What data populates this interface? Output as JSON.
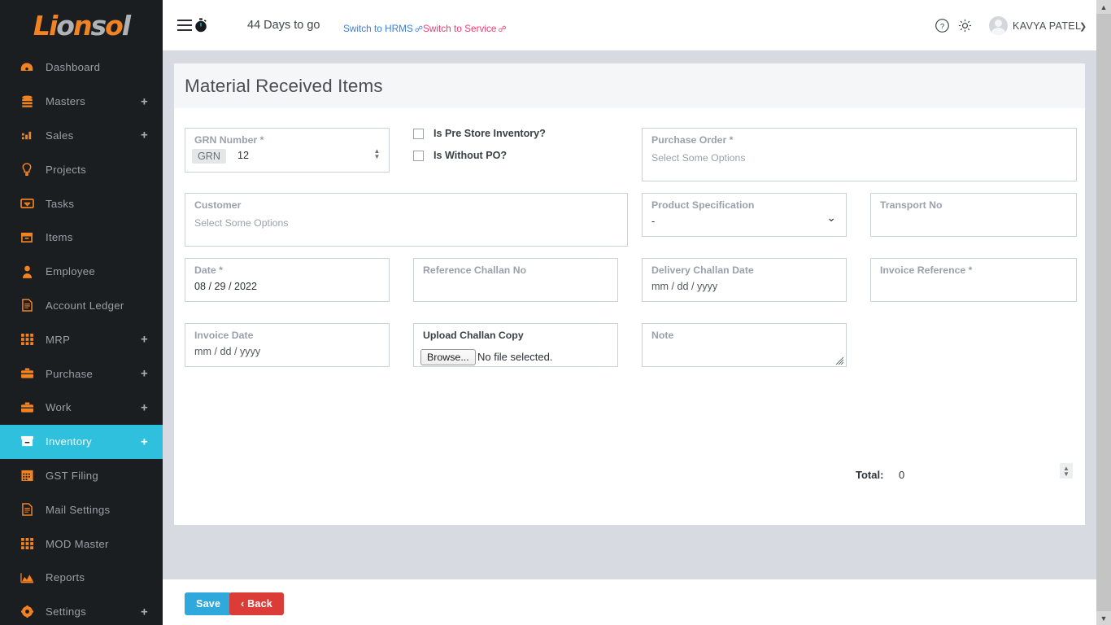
{
  "brand": {
    "logo_part1": "Li",
    "logo_part2": "o",
    "logo_part3": "n",
    "logo_part4": "s",
    "logo_part5": "o",
    "logo_part6": "l",
    "logo_full": "Lionsol",
    "accent_orange": "#f28322",
    "accent_teal": "#2fc0dd",
    "sidebar_bg": "#1b1e21"
  },
  "sidebar": {
    "items": [
      {
        "label": "Dashboard",
        "icon": "dashboard-icon",
        "has_plus": false,
        "active": false
      },
      {
        "label": "Masters",
        "icon": "database-icon",
        "has_plus": true,
        "active": false
      },
      {
        "label": "Sales",
        "icon": "bar-chart-icon",
        "has_plus": true,
        "active": false
      },
      {
        "label": "Projects",
        "icon": "lightbulb-icon",
        "has_plus": false,
        "active": false
      },
      {
        "label": "Tasks",
        "icon": "inbox-icon",
        "has_plus": false,
        "active": false
      },
      {
        "label": "Items",
        "icon": "box-icon",
        "has_plus": false,
        "active": false
      },
      {
        "label": "Employee",
        "icon": "user-icon",
        "has_plus": false,
        "active": false
      },
      {
        "label": "Account Ledger",
        "icon": "document-icon",
        "has_plus": false,
        "active": false
      },
      {
        "label": "MRP",
        "icon": "grid-icon",
        "has_plus": true,
        "active": false
      },
      {
        "label": "Purchase",
        "icon": "briefcase-icon",
        "has_plus": true,
        "active": false
      },
      {
        "label": "Work",
        "icon": "briefcase-icon",
        "has_plus": true,
        "active": false
      },
      {
        "label": "Inventory",
        "icon": "archive-icon",
        "has_plus": true,
        "active": true
      },
      {
        "label": "GST Filing",
        "icon": "calendar-icon",
        "has_plus": false,
        "active": false
      },
      {
        "label": "Mail Settings",
        "icon": "document-icon",
        "has_plus": false,
        "active": false
      },
      {
        "label": "MOD Master",
        "icon": "grid-icon",
        "has_plus": false,
        "active": false
      },
      {
        "label": "Reports",
        "icon": "area-chart-icon",
        "has_plus": false,
        "active": false
      },
      {
        "label": "Settings",
        "icon": "gear-icon",
        "has_plus": true,
        "active": false
      }
    ],
    "plus_glyph": "+"
  },
  "header": {
    "hamburger_icon": "hamburger-menu-icon",
    "timer_icon": "stopwatch-icon",
    "days_to_go": "44 Days to go",
    "link_hrms": "Switch to HRMS",
    "link_service": "Switch to Service",
    "external_glyph": "↗",
    "help_icon": "help-circle-icon",
    "gear_icon": "gear-icon",
    "avatar": "user-avatar",
    "user_name": "KAVYA PATEL",
    "caret_glyph": "⌄",
    "link_hrms_color": "#3a7fe0",
    "link_service_color": "#f7386f"
  },
  "main": {
    "page_title": "Material Received Items",
    "fields": {
      "grn_number": {
        "label": "GRN Number *",
        "prefix": "GRN",
        "value": "12"
      },
      "checkboxes": [
        {
          "label": "Is Pre Store Inventory?",
          "checked": false
        },
        {
          "label": "Is Without PO?",
          "checked": false
        }
      ],
      "purchase_order": {
        "label": "Purchase Order *",
        "placeholder": "Select Some Options"
      },
      "customer": {
        "label": "Customer",
        "placeholder": "Select Some Options"
      },
      "product_specification": {
        "label": "Product Specification",
        "value": "-"
      },
      "transport_no": {
        "label": "Transport No",
        "value": ""
      },
      "date": {
        "label": "Date *",
        "value": "08 / 29 / 2022"
      },
      "reference_challan_no": {
        "label": "Reference Challan No",
        "value": ""
      },
      "delivery_challan_date": {
        "label": "Delivery Challan Date",
        "placeholder": "mm / dd / yyyy"
      },
      "invoice_reference": {
        "label": "Invoice Reference *",
        "value": ""
      },
      "invoice_date": {
        "label": "Invoice Date",
        "placeholder": "mm / dd / yyyy"
      },
      "upload_challan_copy": {
        "label": "Upload Challan Copy",
        "browse_label": "Browse...",
        "file_status": "No file selected."
      },
      "note": {
        "label": "Note",
        "value": ""
      }
    },
    "total": {
      "label": "Total:",
      "value": "0"
    }
  },
  "footer": {
    "save_label": "Save",
    "back_label": "Back",
    "back_glyph": "‹",
    "save_color": "#2fa8dc",
    "back_color": "#dc3c37"
  },
  "scrollbar": {
    "up_glyph": "▲",
    "down_glyph": "▼"
  }
}
